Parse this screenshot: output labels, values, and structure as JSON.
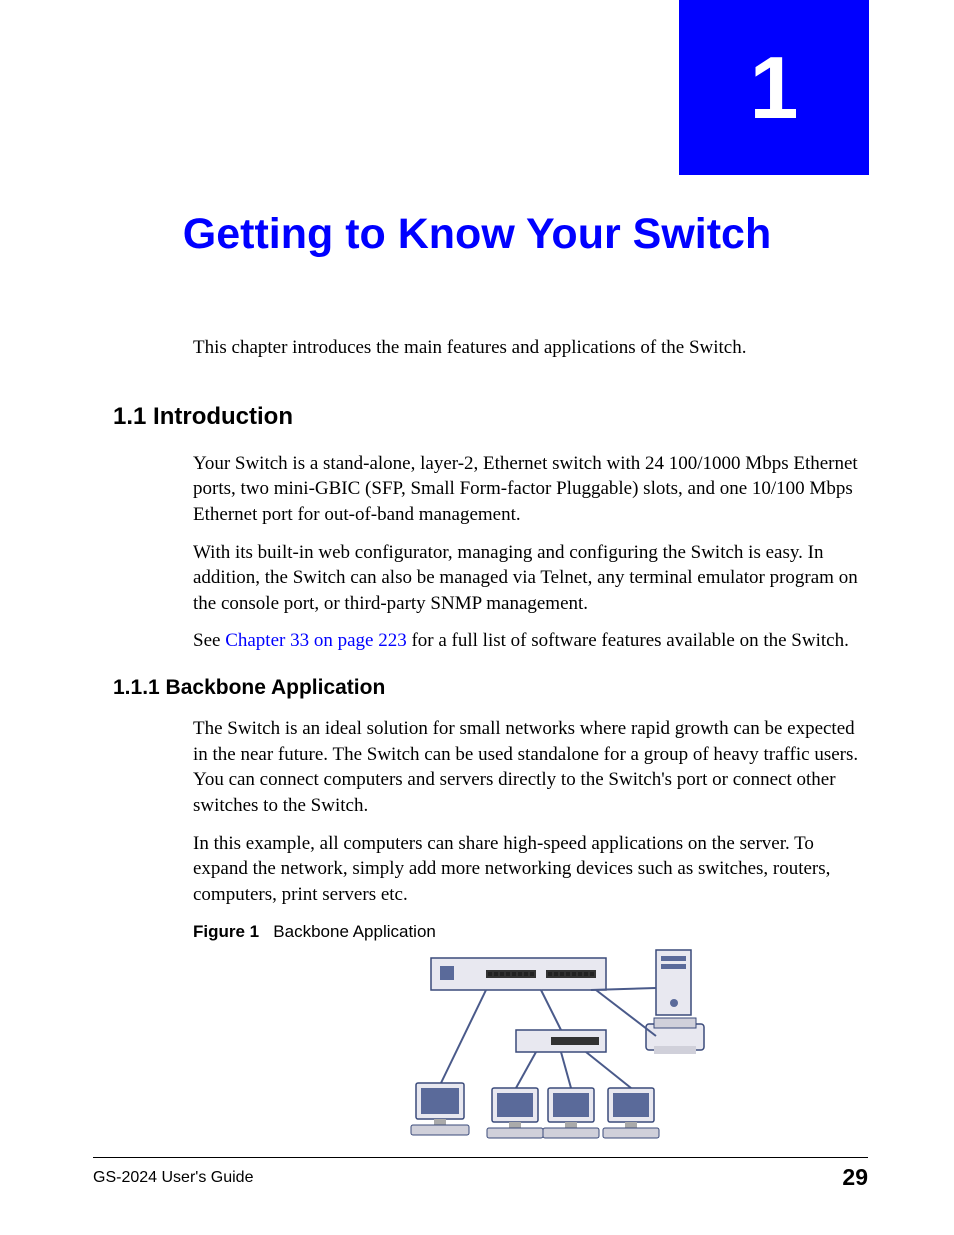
{
  "chapter": {
    "number": "1",
    "title": "Getting to Know Your Switch"
  },
  "intro": "This chapter introduces the main features and applications of the Switch.",
  "section1": {
    "heading": "1.1  Introduction",
    "p1": "Your Switch is a stand-alone, layer-2, Ethernet switch with 24 100/1000 Mbps Ethernet ports, two mini-GBIC (SFP, Small Form-factor Pluggable) slots, and one 10/100 Mbps Ethernet port for out-of-band management.",
    "p2": "With its built-in web configurator, managing and configuring the Switch is easy. In addition, the Switch can also be managed via Telnet, any terminal emulator program on the console port, or third-party SNMP management.",
    "p3_prefix": "See ",
    "p3_link": "Chapter 33 on page 223",
    "p3_suffix": " for a full list of software features available on the Switch."
  },
  "subsection": {
    "heading": "1.1.1  Backbone Application",
    "p1": "The Switch is an ideal solution for small networks where rapid growth can be expected in the near future. The Switch can be used standalone for a group of heavy traffic users. You can connect computers and servers directly to the Switch's port or connect other switches to the Switch.",
    "p2": "In this example, all computers can share high-speed applications on the server. To expand the network, simply add more networking devices such as switches, routers, computers, print servers etc."
  },
  "figure": {
    "label": "Figure 1",
    "title": "Backbone Application"
  },
  "footer": {
    "text": "GS-2024 User's Guide",
    "page": "29"
  }
}
